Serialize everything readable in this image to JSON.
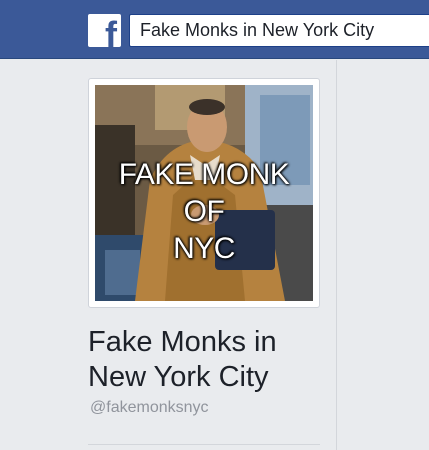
{
  "colors": {
    "brand": "#3b5998",
    "background": "#e9ebee",
    "muted": "#90949c"
  },
  "header": {
    "logo_icon": "facebook-f-icon",
    "search_value": "Fake Monks in New York City"
  },
  "profile": {
    "photo_overlay": [
      "FAKE MONK",
      "OF",
      "NYC"
    ],
    "name": "Fake Monks in New York City",
    "handle": "@fakemonksnyc"
  }
}
